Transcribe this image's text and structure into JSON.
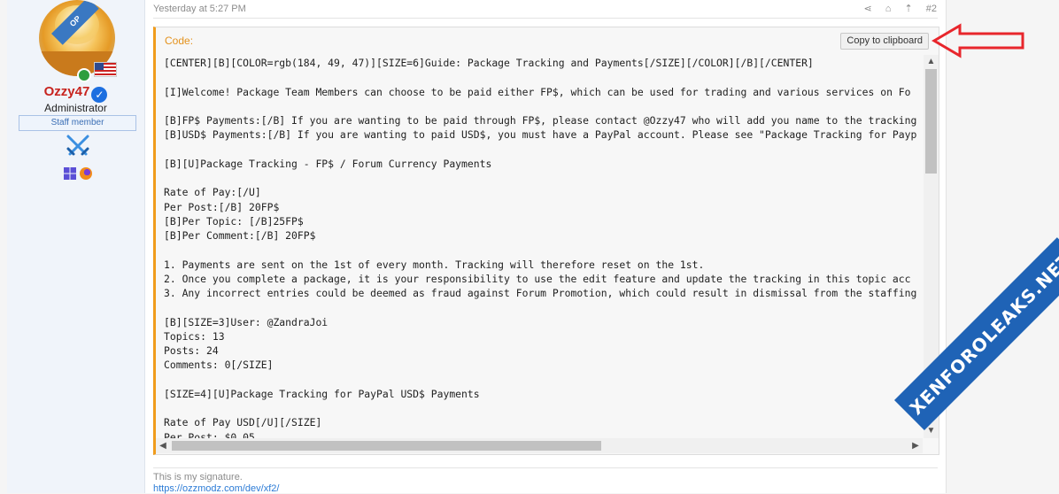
{
  "post": {
    "timestamp": "Yesterday at 5:27 PM",
    "post_number": "#2",
    "action_icons": [
      "share-icon",
      "bookmark-icon",
      "jump-top-icon"
    ]
  },
  "user": {
    "ribbon": "OP",
    "name": "Ozzy47",
    "title": "Administrator",
    "badge": "Staff member"
  },
  "code_block": {
    "title": "Code:",
    "copy_label": "Copy to clipboard",
    "lines": [
      "[CENTER][B][COLOR=rgb(184, 49, 47)][SIZE=6]Guide: Package Tracking and Payments[/SIZE][/COLOR][/B][/CENTER]",
      "",
      "[I]Welcome! Package Team Members can choose to be paid either FP$, which can be used for trading and various services on Fo",
      "",
      "[B]FP$ Payments:[/B] If you are wanting to be paid through FP$, please contact @Ozzy47 who will add you name to the tracking",
      "[B]USD$ Payments:[/B] If you are wanting to paid USD$, you must have a PayPal account. Please see \"Package Tracking for Payp",
      "",
      "[B][U]Package Tracking - FP$ / Forum Currency Payments",
      "",
      "Rate of Pay:[/U]",
      "Per Post:[/B] 20FP$",
      "[B]Per Topic: [/B]25FP$",
      "[B]Per Comment:[/B] 20FP$",
      "",
      "1. Payments are sent on the 1st of every month. Tracking will therefore reset on the 1st.",
      "2. Once you complete a package, it is your responsibility to use the edit feature and update the tracking in this topic acc",
      "3. Any incorrect entries could be deemed as fraud against Forum Promotion, which could result in dismissal from the staffing",
      "",
      "[B][SIZE=3]User: @ZandraJoi",
      "Topics: 13",
      "Posts: 24",
      "Comments: 0[/SIZE]",
      "",
      "[SIZE=4][U]Package Tracking for PayPal USD$ Payments",
      "",
      "Rate of Pay USD[/U][/SIZE]",
      "Per Post: $0.05"
    ]
  },
  "signature": {
    "text": "This is my signature.",
    "link": "https://ozzmodz.com/dev/xf2/"
  },
  "watermark": "XENFOROLEAKS.NET",
  "colors": {
    "accent_orange": "#f09c1c",
    "username_red": "#c7231e",
    "annotation_red": "#e8262c",
    "watermark_blue": "#1f63b6"
  }
}
